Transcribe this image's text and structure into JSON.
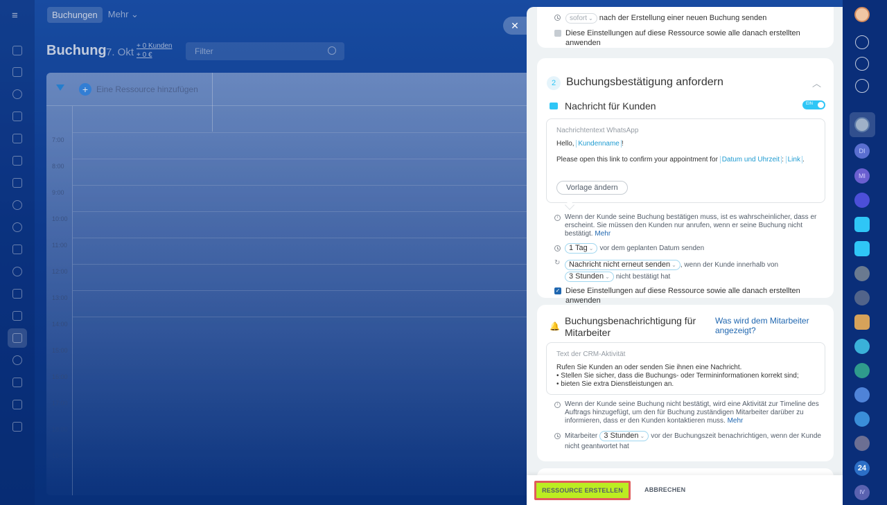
{
  "background": {
    "nav": {
      "buchungen": "Buchungen",
      "mehr": "Mehr"
    },
    "title": "Buchung",
    "date": "7. Okt",
    "kunden_line1": "+ 0 Kunden",
    "kunden_line2": "+ 0 €",
    "filter_placeholder": "Filter",
    "add_resource": "Eine Ressource hinzufügen",
    "times": [
      "7:00",
      "8:00",
      "9:00",
      "10:00",
      "11:00",
      "12:00",
      "13:00",
      "14:00",
      "15:00",
      "16:00",
      "17:00",
      "18:00",
      "19:00"
    ]
  },
  "slider": {
    "section1": {
      "send_pill": "sofort",
      "send_text": "nach der Erstellung einer neuen Buchung senden",
      "apply_text": "Diese Einstellungen auf diese Ressource sowie alle danach erstellten anwenden"
    },
    "section2": {
      "number": "2",
      "title": "Buchungsbestätigung anfordern",
      "sub_title": "Nachricht für Kunden",
      "toggle_label": "EIN",
      "box_label": "Nachrichtentext WhatsApp",
      "greeting": "Hello,",
      "tag_kunde": "Kundenname",
      "greeting_end": "!",
      "body_text": "Please open this link to confirm your appointment for",
      "tag_datum": "Datum und Uhrzeit",
      "colon": ":",
      "tag_link": "Link",
      "period": ".",
      "vorlage_button": "Vorlage ändern",
      "info_text": "Wenn der Kunde seine Buchung bestätigen muss, ist es wahrscheinlicher, dass er erscheint. Sie müssen den Kunden nur anrufen, wenn er seine Buchung nicht bestätigt.",
      "info_link": "Mehr",
      "send_pill": "1 Tag",
      "send_text": "vor dem geplanten Datum senden",
      "resend_pill": "Nachricht nicht erneut senden",
      "resend_text": ", wenn der Kunde innerhalb von",
      "hours_pill": "3 Stunden",
      "hours_text": "nicht bestätigt hat",
      "apply_text": "Diese Einstellungen auf diese Ressource sowie alle danach erstellten anwenden"
    },
    "section3": {
      "title": "Buchungsbenachrichtigung für Mitarbeiter",
      "link": "Was wird dem Mitarbeiter angezeigt?",
      "box_label": "Text der CRM-Aktivität",
      "line1": "Rufen Sie Kunden an oder senden Sie ihnen eine Nachricht.",
      "line2": "• Stellen Sie sicher, dass die Buchungs- oder Termininformationen korrekt sind;",
      "line3": "• bieten Sie extra Dienstleistungen an.",
      "info_text": "Wenn der Kunde seine Buchung nicht bestätigt, wird eine Aktivität zur Timeline des Auftrags hinzugefügt, um den für Buchung zuständigen Mitarbeiter darüber zu informieren, dass er den Kunden kontaktieren muss.",
      "info_link": "Mehr",
      "notify_prefix": "Mitarbeiter",
      "notify_pill": "3 Stunden",
      "notify_text": "vor der Buchungszeit benachrichtigen, wenn der Kunde nicht geantwortet hat"
    }
  },
  "footer": {
    "create_button": "RESSOURCE ERSTELLEN",
    "cancel_button": "ABBRECHEN"
  },
  "right_bar": {
    "avatar_di": "DI",
    "avatar_mi": "MI",
    "badge_24": "24",
    "avatar_iv": "IV"
  },
  "colors": {
    "accent": "#2fc6f6",
    "primary_button": "#bbed21",
    "highlight_border": "#e05c5c",
    "link": "#2067b0"
  }
}
